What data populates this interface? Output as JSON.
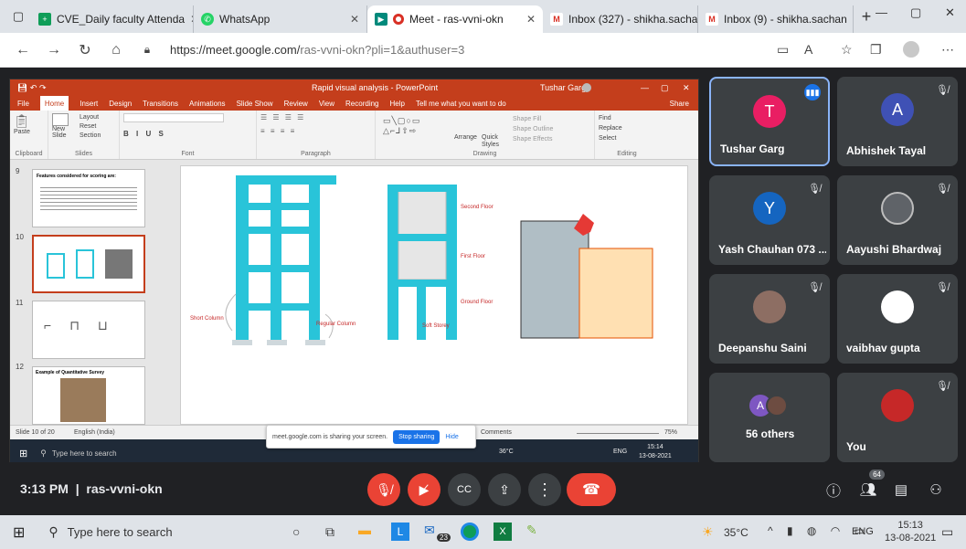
{
  "browser": {
    "tabs": [
      {
        "label": "CVE_Daily faculty Attenda",
        "fav": "+",
        "fav_color": "#0f9d58"
      },
      {
        "label": "WhatsApp",
        "fav": "✆",
        "fav_color": "#25d366"
      },
      {
        "label": "Meet - ras-vvni-okn",
        "fav": "▶",
        "fav_color": "#00897b",
        "active": true
      },
      {
        "label": "Inbox (327) - shikha.sacha",
        "fav": "M",
        "fav_color": "#d93025"
      },
      {
        "label": "Inbox (9) - shikha.sachan",
        "fav": "M",
        "fav_color": "#d93025"
      }
    ],
    "url_host": "https://meet.google.com/",
    "url_path": "ras-vvni-okn?pli=1&authuser=3"
  },
  "ppt": {
    "title": "Rapid visual analysis - PowerPoint",
    "user": "Tushar Garg",
    "menu": [
      "File",
      "Home",
      "Insert",
      "Design",
      "Transitions",
      "Animations",
      "Slide Show",
      "Review",
      "View",
      "Recording",
      "Help",
      "Tell me what you want to do"
    ],
    "share_label": "Share",
    "groups": [
      "Clipboard",
      "Slides",
      "Font",
      "Paragraph",
      "Drawing",
      "Editing"
    ],
    "ribbon_text": {
      "paste": "Paste",
      "new_slide": "New Slide",
      "layout": "Layout",
      "reset": "Reset",
      "section": "Section",
      "arrange": "Arrange",
      "quick_styles": "Quick Styles",
      "shape_fill": "Shape Fill",
      "shape_outline": "Shape Outline",
      "shape_effects": "Shape Effects",
      "find": "Find",
      "replace": "Replace",
      "select": "Select"
    },
    "thumb_numbers": [
      "9",
      "10",
      "11",
      "12"
    ],
    "thumb9_title": "Features considered for scoring are:",
    "thumb12_title": "Example of Quantitative Survey",
    "slide_labels": {
      "short_column": "Short Column",
      "regular_column": "Regular Column",
      "soft_storey": "Soft Storey",
      "second_floor": "Second Floor",
      "first_floor": "First Floor",
      "ground_floor": "Ground Floor"
    },
    "status_slide": "Slide 10 of 20",
    "status_lang": "English (India)",
    "status_comments": "Comments",
    "status_zoom": "75%",
    "inner_search": "Type here to search",
    "inner_temp": "36°C",
    "inner_lang": "ENG",
    "inner_time": "15:14",
    "inner_date": "13-08-2021"
  },
  "sharebar": {
    "text": "meet.google.com is sharing your screen.",
    "stop": "Stop sharing",
    "hide": "Hide"
  },
  "participants": [
    {
      "name": "Tushar Garg",
      "initial": "T",
      "color": "#e91e63",
      "speaking": true
    },
    {
      "name": "Abhishek Tayal",
      "initial": "A",
      "color": "#3f51b5"
    },
    {
      "name": "Yash Chauhan 073 ...",
      "initial": "Y",
      "color": "#1565c0"
    },
    {
      "name": "Aayushi Bhardwaj",
      "initial": "",
      "color": "#5f6368"
    },
    {
      "name": "Deepanshu Saini",
      "initial": "",
      "color": "#8d6e63"
    },
    {
      "name": "vaibhav gupta",
      "initial": "",
      "color": "#ffffff"
    },
    {
      "name": "56 others",
      "initial": "A",
      "color": "#7e57c2"
    },
    {
      "name": "You",
      "initial": "",
      "color": "#c62828"
    }
  ],
  "meeting": {
    "time": "3:13 PM",
    "code": "ras-vvni-okn",
    "people_count": "64"
  },
  "taskbar": {
    "search": "Type here to search",
    "badge": "23",
    "temp": "35°C",
    "lang": "ENG",
    "time": "15:13",
    "date": "13-08-2021"
  }
}
